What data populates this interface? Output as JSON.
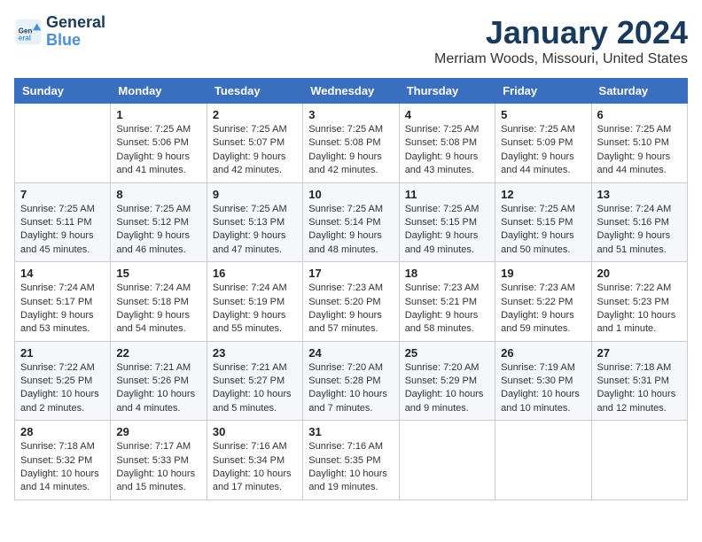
{
  "logo": {
    "line1": "General",
    "line2": "Blue"
  },
  "title": "January 2024",
  "location": "Merriam Woods, Missouri, United States",
  "days_of_week": [
    "Sunday",
    "Monday",
    "Tuesday",
    "Wednesday",
    "Thursday",
    "Friday",
    "Saturday"
  ],
  "weeks": [
    [
      {
        "day": "",
        "sunrise": "",
        "sunset": "",
        "daylight": ""
      },
      {
        "day": "1",
        "sunrise": "Sunrise: 7:25 AM",
        "sunset": "Sunset: 5:06 PM",
        "daylight": "Daylight: 9 hours and 41 minutes."
      },
      {
        "day": "2",
        "sunrise": "Sunrise: 7:25 AM",
        "sunset": "Sunset: 5:07 PM",
        "daylight": "Daylight: 9 hours and 42 minutes."
      },
      {
        "day": "3",
        "sunrise": "Sunrise: 7:25 AM",
        "sunset": "Sunset: 5:08 PM",
        "daylight": "Daylight: 9 hours and 42 minutes."
      },
      {
        "day": "4",
        "sunrise": "Sunrise: 7:25 AM",
        "sunset": "Sunset: 5:08 PM",
        "daylight": "Daylight: 9 hours and 43 minutes."
      },
      {
        "day": "5",
        "sunrise": "Sunrise: 7:25 AM",
        "sunset": "Sunset: 5:09 PM",
        "daylight": "Daylight: 9 hours and 44 minutes."
      },
      {
        "day": "6",
        "sunrise": "Sunrise: 7:25 AM",
        "sunset": "Sunset: 5:10 PM",
        "daylight": "Daylight: 9 hours and 44 minutes."
      }
    ],
    [
      {
        "day": "7",
        "sunrise": "Sunrise: 7:25 AM",
        "sunset": "Sunset: 5:11 PM",
        "daylight": "Daylight: 9 hours and 45 minutes."
      },
      {
        "day": "8",
        "sunrise": "Sunrise: 7:25 AM",
        "sunset": "Sunset: 5:12 PM",
        "daylight": "Daylight: 9 hours and 46 minutes."
      },
      {
        "day": "9",
        "sunrise": "Sunrise: 7:25 AM",
        "sunset": "Sunset: 5:13 PM",
        "daylight": "Daylight: 9 hours and 47 minutes."
      },
      {
        "day": "10",
        "sunrise": "Sunrise: 7:25 AM",
        "sunset": "Sunset: 5:14 PM",
        "daylight": "Daylight: 9 hours and 48 minutes."
      },
      {
        "day": "11",
        "sunrise": "Sunrise: 7:25 AM",
        "sunset": "Sunset: 5:15 PM",
        "daylight": "Daylight: 9 hours and 49 minutes."
      },
      {
        "day": "12",
        "sunrise": "Sunrise: 7:25 AM",
        "sunset": "Sunset: 5:15 PM",
        "daylight": "Daylight: 9 hours and 50 minutes."
      },
      {
        "day": "13",
        "sunrise": "Sunrise: 7:24 AM",
        "sunset": "Sunset: 5:16 PM",
        "daylight": "Daylight: 9 hours and 51 minutes."
      }
    ],
    [
      {
        "day": "14",
        "sunrise": "Sunrise: 7:24 AM",
        "sunset": "Sunset: 5:17 PM",
        "daylight": "Daylight: 9 hours and 53 minutes."
      },
      {
        "day": "15",
        "sunrise": "Sunrise: 7:24 AM",
        "sunset": "Sunset: 5:18 PM",
        "daylight": "Daylight: 9 hours and 54 minutes."
      },
      {
        "day": "16",
        "sunrise": "Sunrise: 7:24 AM",
        "sunset": "Sunset: 5:19 PM",
        "daylight": "Daylight: 9 hours and 55 minutes."
      },
      {
        "day": "17",
        "sunrise": "Sunrise: 7:23 AM",
        "sunset": "Sunset: 5:20 PM",
        "daylight": "Daylight: 9 hours and 57 minutes."
      },
      {
        "day": "18",
        "sunrise": "Sunrise: 7:23 AM",
        "sunset": "Sunset: 5:21 PM",
        "daylight": "Daylight: 9 hours and 58 minutes."
      },
      {
        "day": "19",
        "sunrise": "Sunrise: 7:23 AM",
        "sunset": "Sunset: 5:22 PM",
        "daylight": "Daylight: 9 hours and 59 minutes."
      },
      {
        "day": "20",
        "sunrise": "Sunrise: 7:22 AM",
        "sunset": "Sunset: 5:23 PM",
        "daylight": "Daylight: 10 hours and 1 minute."
      }
    ],
    [
      {
        "day": "21",
        "sunrise": "Sunrise: 7:22 AM",
        "sunset": "Sunset: 5:25 PM",
        "daylight": "Daylight: 10 hours and 2 minutes."
      },
      {
        "day": "22",
        "sunrise": "Sunrise: 7:21 AM",
        "sunset": "Sunset: 5:26 PM",
        "daylight": "Daylight: 10 hours and 4 minutes."
      },
      {
        "day": "23",
        "sunrise": "Sunrise: 7:21 AM",
        "sunset": "Sunset: 5:27 PM",
        "daylight": "Daylight: 10 hours and 5 minutes."
      },
      {
        "day": "24",
        "sunrise": "Sunrise: 7:20 AM",
        "sunset": "Sunset: 5:28 PM",
        "daylight": "Daylight: 10 hours and 7 minutes."
      },
      {
        "day": "25",
        "sunrise": "Sunrise: 7:20 AM",
        "sunset": "Sunset: 5:29 PM",
        "daylight": "Daylight: 10 hours and 9 minutes."
      },
      {
        "day": "26",
        "sunrise": "Sunrise: 7:19 AM",
        "sunset": "Sunset: 5:30 PM",
        "daylight": "Daylight: 10 hours and 10 minutes."
      },
      {
        "day": "27",
        "sunrise": "Sunrise: 7:18 AM",
        "sunset": "Sunset: 5:31 PM",
        "daylight": "Daylight: 10 hours and 12 minutes."
      }
    ],
    [
      {
        "day": "28",
        "sunrise": "Sunrise: 7:18 AM",
        "sunset": "Sunset: 5:32 PM",
        "daylight": "Daylight: 10 hours and 14 minutes."
      },
      {
        "day": "29",
        "sunrise": "Sunrise: 7:17 AM",
        "sunset": "Sunset: 5:33 PM",
        "daylight": "Daylight: 10 hours and 15 minutes."
      },
      {
        "day": "30",
        "sunrise": "Sunrise: 7:16 AM",
        "sunset": "Sunset: 5:34 PM",
        "daylight": "Daylight: 10 hours and 17 minutes."
      },
      {
        "day": "31",
        "sunrise": "Sunrise: 7:16 AM",
        "sunset": "Sunset: 5:35 PM",
        "daylight": "Daylight: 10 hours and 19 minutes."
      },
      {
        "day": "",
        "sunrise": "",
        "sunset": "",
        "daylight": ""
      },
      {
        "day": "",
        "sunrise": "",
        "sunset": "",
        "daylight": ""
      },
      {
        "day": "",
        "sunrise": "",
        "sunset": "",
        "daylight": ""
      }
    ]
  ]
}
